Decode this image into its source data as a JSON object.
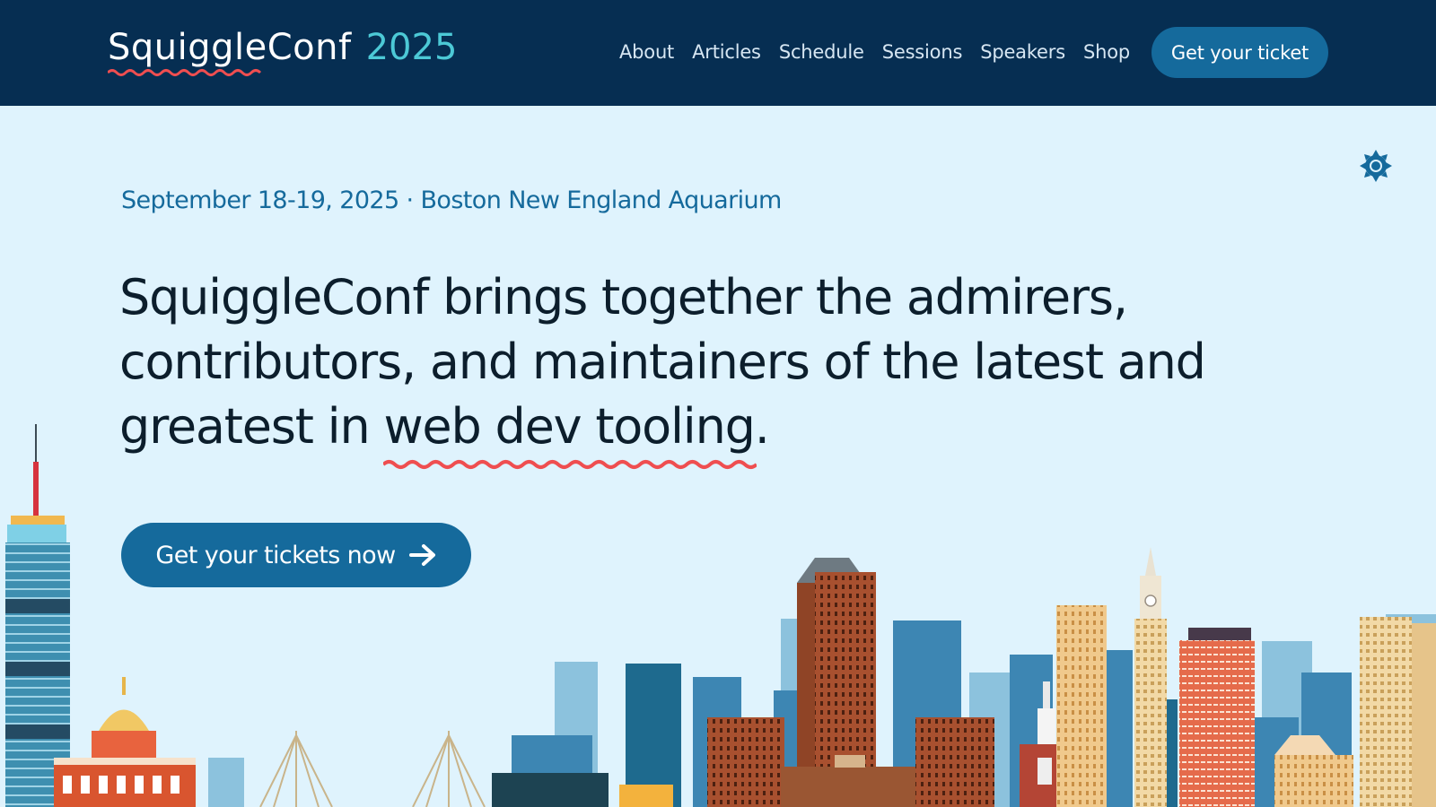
{
  "header": {
    "logo_name": "SquiggleConf",
    "logo_year": "2025",
    "nav": [
      {
        "label": "About"
      },
      {
        "label": "Articles"
      },
      {
        "label": "Schedule"
      },
      {
        "label": "Sessions"
      },
      {
        "label": "Speakers"
      },
      {
        "label": "Shop"
      }
    ],
    "cta_label": "Get your ticket"
  },
  "theme_toggle": {
    "icon": "gear-icon"
  },
  "hero": {
    "event_meta": "September 18-19, 2025 · Boston New England Aquarium",
    "heading_before": "SquiggleConf brings together the admirers, contributors, and maintainers of the latest and greatest in ",
    "heading_highlight": "web dev tooling",
    "heading_after": ".",
    "cta_label": "Get your tickets now",
    "cta_icon": "arrow-right-icon"
  },
  "colors": {
    "header_bg": "#062e52",
    "accent": "#156a9c",
    "year": "#4cc9d6",
    "squiggle": "#ef4e50",
    "page_bg": "#dff3fd",
    "text": "#0c1e2c"
  }
}
